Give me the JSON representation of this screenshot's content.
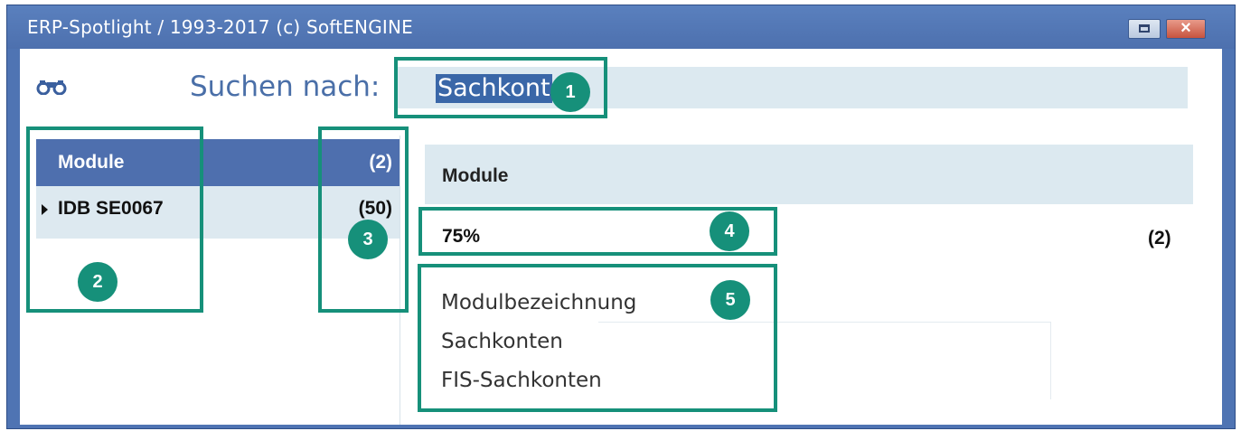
{
  "window": {
    "title": "ERP-Spotlight / 1993-2017 (c) SoftENGINE",
    "close_glyph": "×"
  },
  "search": {
    "label": "Suchen nach:",
    "value": "Sachkont",
    "icon": "binoculars-icon"
  },
  "left_panel": {
    "header": {
      "label": "Module",
      "count": "(2)"
    },
    "rows": [
      {
        "label": "IDB SE0067",
        "count": "(50)"
      }
    ]
  },
  "right_panel": {
    "header": "Module",
    "relevance": "75%",
    "count": "(2)",
    "results": [
      "Modulbezeichnung",
      "Sachkonten",
      "FIS-Sachkonten"
    ]
  },
  "callouts": [
    "1",
    "2",
    "3",
    "4",
    "5"
  ],
  "colors": {
    "title_bar": "#4f74b3",
    "accent_callout": "#16907a",
    "header_bg": "#4e6fae",
    "row_bg": "#dde9f0",
    "selection": "#3a67a8"
  }
}
